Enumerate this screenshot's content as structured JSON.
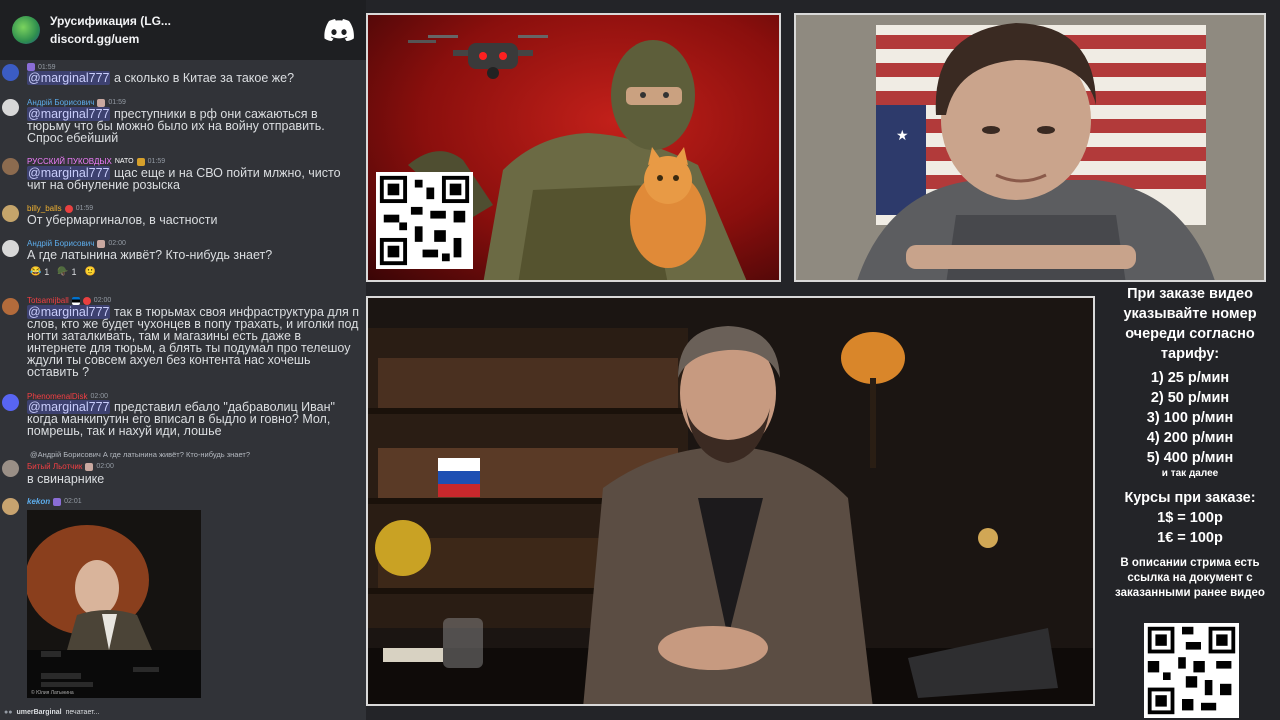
{
  "server": {
    "name": "Урусификация (LG...",
    "link": "discord.gg/uem"
  },
  "messages": [
    {
      "id": "m1",
      "time": "01:59",
      "body_mention": "@marginal777",
      "body_text": " а сколько в Китае за такое же?"
    },
    {
      "id": "m2",
      "author": "Андрій Борисович",
      "time": "01:59",
      "author_color": "#5dadec",
      "body_mention": "@marginal777",
      "body_text": " преступники в рф они сажаються в тюрьму что бы можно было их на войну отправить. Спрос ебейший"
    },
    {
      "id": "m3",
      "author": "РУССКИЙ ПУКОВДЫХ",
      "tag": "NATO",
      "time": "01:59",
      "author_color": "#f47fff",
      "body_mention": "@marginal777",
      "body_text": " щас еще и на СВО пойти млжно, чисто чит на обнуление розыска"
    },
    {
      "id": "m4",
      "author": "billy_balls",
      "time": "01:59",
      "author_color": "#f0b232",
      "body_text": "От убермаргиналов, в частности"
    },
    {
      "id": "m5",
      "author": "Андрій Борисович",
      "time": "02:00",
      "author_color": "#5dadec",
      "body_text": "А где латынина живёт? Кто-нибудь знает?"
    },
    {
      "id": "m6",
      "author": "Totsamijball",
      "time": "02:00",
      "author_color": "#f23f43",
      "body_mention": "@marginal777",
      "body_text": " так в тюрьмах своя инфраструктура для п слов, кто же будет чухонцев в попу трахать, и иголки под ногти заталкивать, там и магазины есть даже в интернете для тюрьм, а блять ты подумал про телешоу ждули ты совсем ахуел без контента нас хочешь оставить ?"
    },
    {
      "id": "m7",
      "author": "PhenomenalDisk",
      "time": "02:00",
      "author_color": "#f23f43",
      "body_mention": "@marginal777",
      "body_text": " представил ебало \"дабраволиц Иван\" когда манкипутин его вписал в быдло и говно? Мол, помрешь, так и нахуй иди, лошье"
    },
    {
      "id": "m8",
      "reply_author": "@Андрій Борисович",
      "reply_text": "А где латынина живёт? Кто-нибудь знает?",
      "author": "Битый Льотчик",
      "time": "02:00",
      "author_color": "#f23f43",
      "body_text": "в свинарнике"
    },
    {
      "id": "m9",
      "author": "kekon",
      "time": "02:01",
      "author_color": "#5dadec",
      "embed_caption": "© Юлия Латынина"
    }
  ],
  "reactions": [
    {
      "emoji": "😂",
      "count": "1"
    },
    {
      "emoji": "🪖",
      "count": "1"
    },
    {
      "emoji": "🙂",
      "count": ""
    }
  ],
  "typing": {
    "user": "umerBarginal",
    "text": "печатает..."
  },
  "info": {
    "title": "При заказе видео указывайте номер очереди согласно тарифу:",
    "tariffs": [
      "1) 25 р/мин",
      "2) 50 р/мин",
      "3) 100 р/мин",
      "4) 200 р/мин",
      "5) 400 р/мин"
    ],
    "etc": "и так далее",
    "rates_title": "Курсы при заказе:",
    "rates": [
      "1$ = 100р",
      "1€ = 100р"
    ],
    "description": "В описании стрима есть ссылка на документ с заказанными ранее видео"
  },
  "colors": {
    "chat_bg": "#313338",
    "mention": "#c9cdfb",
    "accent": "#5865f2"
  }
}
